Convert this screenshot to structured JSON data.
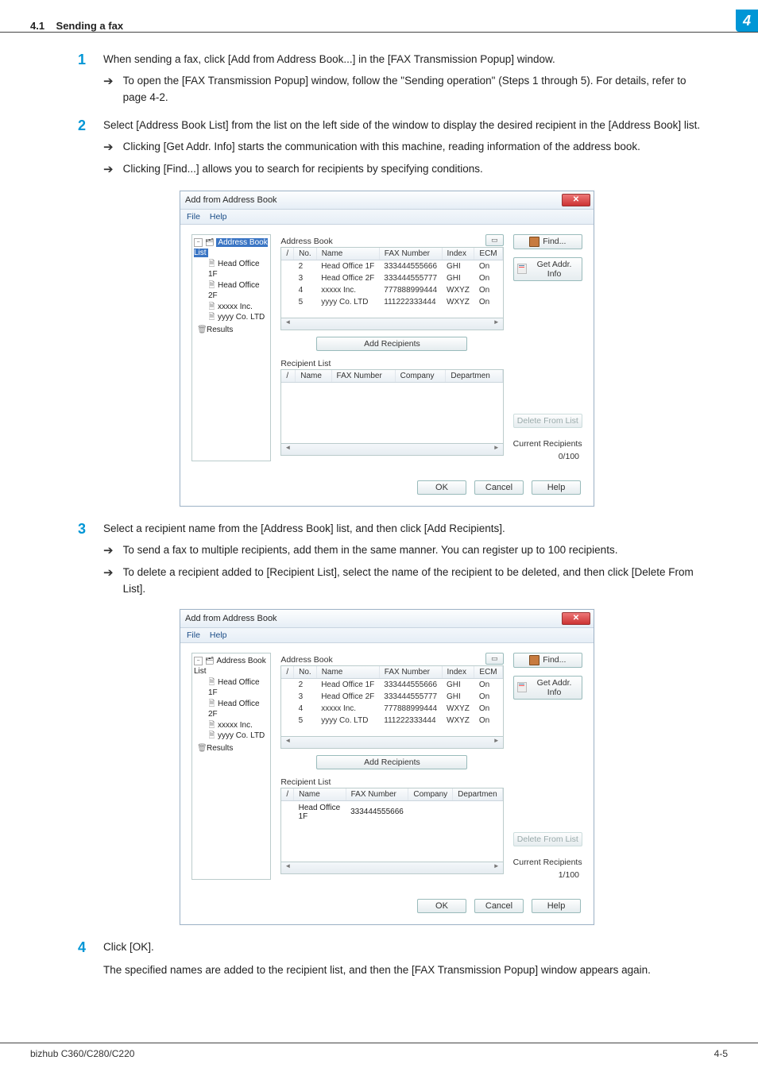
{
  "header": {
    "section": "4.1",
    "title": "Sending a fax",
    "chapter": "4"
  },
  "steps": [
    {
      "num": "1",
      "text": "When sending a fax, click [Add from Address Book...] in the [FAX Transmission Popup] window.",
      "subs": [
        "To open the [FAX Transmission Popup] window, follow the \"Sending operation\" (Steps 1 through 5). For details, refer to page 4-2."
      ]
    },
    {
      "num": "2",
      "text": "Select [Address Book List] from the list on the left side of the window to display the desired recipient in the [Address Book] list.",
      "subs": [
        "Clicking [Get Addr. Info] starts the communication with this machine, reading information of the address book.",
        "Clicking [Find...] allows you to search for recipients by specifying conditions."
      ]
    },
    {
      "num": "3",
      "text": "Select a recipient name from the [Address Book] list, and then click [Add Recipients].",
      "subs": [
        "To send a fax to multiple recipients, add them in the same manner. You can register up to 100 recipients.",
        "To delete a recipient added to [Recipient List], select the name of the recipient to be deleted, and then click [Delete From List]."
      ]
    },
    {
      "num": "4",
      "text": "Click [OK].",
      "after": "The specified names are added to the recipient list, and then the [FAX Transmission Popup] window appears again."
    }
  ],
  "window": {
    "title_prefix": "⬚ ",
    "title": "Add from Address Book",
    "menu": [
      "File",
      "Help"
    ],
    "tree": {
      "root": "Address Book List",
      "children": [
        "Head Office 1F",
        "Head Office 2F",
        "xxxxx Inc.",
        "yyyy Co. LTD"
      ],
      "results": "Results"
    },
    "address_book_label": "Address Book",
    "columns": [
      "/",
      "No.",
      "Name",
      "FAX Number",
      "Index",
      "ECM"
    ],
    "rows": [
      {
        "no": "2",
        "name": "Head Office 1F",
        "fax": "333444555666",
        "index": "GHI",
        "ecm": "On"
      },
      {
        "no": "3",
        "name": "Head Office 2F",
        "fax": "333444555777",
        "index": "GHI",
        "ecm": "On"
      },
      {
        "no": "4",
        "name": "xxxxx Inc.",
        "fax": "777888999444",
        "index": "WXYZ",
        "ecm": "On"
      },
      {
        "no": "5",
        "name": "yyyy Co. LTD",
        "fax": "111222333444",
        "index": "WXYZ",
        "ecm": "On"
      }
    ],
    "add_btn": "Add Recipients",
    "recipient_list_label": "Recipient List",
    "recipient_columns": [
      "/",
      "Name",
      "FAX Number",
      "Company",
      "Departmen"
    ],
    "recipient_rows_b": [
      {
        "name": "Head Office 1F",
        "fax": "333444555666"
      }
    ],
    "buttons": {
      "find": "Find...",
      "get_addr": "Get Addr. Info",
      "delete": "Delete From List",
      "current": "Current Recipients",
      "ok": "OK",
      "cancel": "Cancel",
      "help": "Help"
    },
    "count_a": "0/100",
    "count_b": "1/100",
    "mini_btn": "▭"
  },
  "footer": {
    "left": "bizhub C360/C280/C220",
    "right": "4-5"
  }
}
